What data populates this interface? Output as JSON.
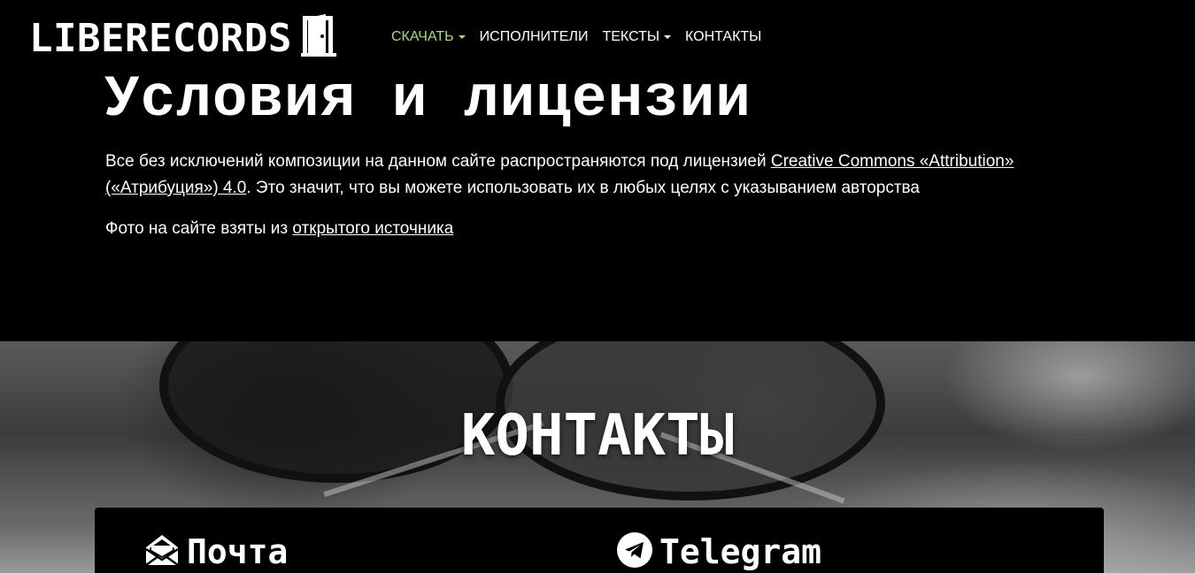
{
  "brand": {
    "name": "LIBERECORDS",
    "icon": "door-icon"
  },
  "nav": {
    "items": [
      {
        "label": "СКАЧАТЬ",
        "dropdown": true,
        "active": true
      },
      {
        "label": "ИСПОЛНИТЕЛИ",
        "dropdown": false,
        "active": false
      },
      {
        "label": "ТЕКСТЫ",
        "dropdown": true,
        "active": false
      },
      {
        "label": "КОНТАКТЫ",
        "dropdown": false,
        "active": false
      }
    ],
    "active_color": "#a4e061"
  },
  "license": {
    "title": "Условия и лицензии",
    "p1_text_before": "Все без исключений композиции на данном сайте распространяются под лицензией ",
    "p1_link": "Creative Commons «Attribution» («Атрибуция») 4.0",
    "p1_text_after": ". Это значит, что вы можете использовать их в любых целях с указыванием авторства",
    "p2_text_before": "Фото на сайте взяты из ",
    "p2_link": "открытого источника"
  },
  "contacts": {
    "title": "КОНТАКТЫ",
    "mail": {
      "label": "Почта",
      "icon": "envelope-icon"
    },
    "telegram": {
      "label": "Telegram",
      "icon": "telegram-icon"
    }
  }
}
